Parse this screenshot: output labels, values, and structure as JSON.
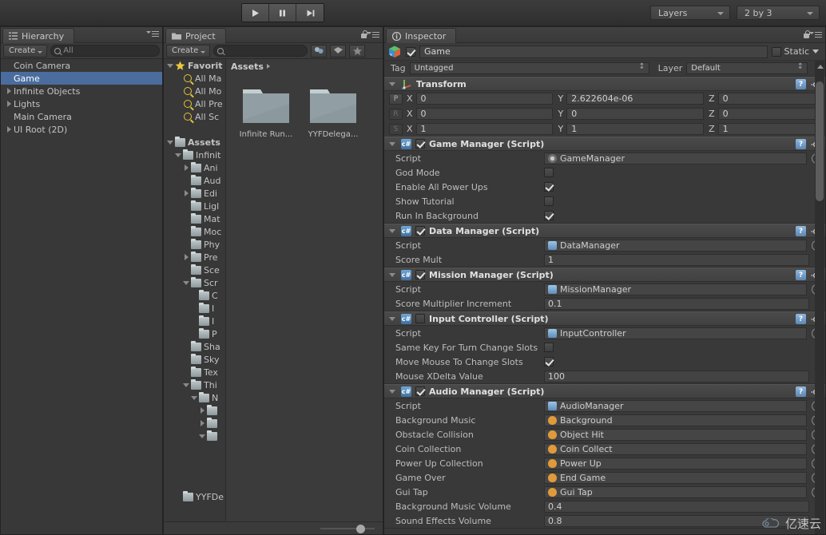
{
  "toolbar": {
    "play_label": "play-icon",
    "pause_label": "pause-icon",
    "step_label": "step-icon",
    "layers_label": "Layers",
    "layout_label": "2 by 3"
  },
  "hierarchy": {
    "tab_label": "Hierarchy",
    "create_label": "Create",
    "search_value": "All",
    "items": [
      {
        "label": "Coin Camera",
        "twisty": "none",
        "selected": false
      },
      {
        "label": "Game",
        "twisty": "none",
        "selected": true
      },
      {
        "label": "Infinite Objects",
        "twisty": "closed",
        "selected": false
      },
      {
        "label": "Lights",
        "twisty": "closed",
        "selected": false
      },
      {
        "label": "Main Camera",
        "twisty": "none",
        "selected": false
      },
      {
        "label": "UI Root (2D)",
        "twisty": "closed",
        "selected": false
      }
    ]
  },
  "project": {
    "tab_label": "Project",
    "create_label": "Create",
    "search_value": "",
    "breadcrumb": "Assets",
    "tree": [
      {
        "label": "Favorit",
        "indent": 0,
        "twisty": "open",
        "icon": "star",
        "bold": true
      },
      {
        "label": "All Ma",
        "indent": 1,
        "twisty": "none",
        "icon": "search",
        "bold": false
      },
      {
        "label": "All Mo",
        "indent": 1,
        "twisty": "none",
        "icon": "search",
        "bold": false
      },
      {
        "label": "All Pre",
        "indent": 1,
        "twisty": "none",
        "icon": "search",
        "bold": false
      },
      {
        "label": "All Sc",
        "indent": 1,
        "twisty": "none",
        "icon": "search",
        "bold": false
      },
      {
        "label": "",
        "indent": 0,
        "twisty": "none",
        "icon": "none",
        "bold": false
      },
      {
        "label": "Assets",
        "indent": 0,
        "twisty": "open",
        "icon": "folder",
        "bold": true
      },
      {
        "label": "Infinit",
        "indent": 1,
        "twisty": "open",
        "icon": "folder",
        "bold": false
      },
      {
        "label": "Ani",
        "indent": 2,
        "twisty": "closed",
        "icon": "folder",
        "bold": false
      },
      {
        "label": "Aud",
        "indent": 2,
        "twisty": "none",
        "icon": "folder",
        "bold": false
      },
      {
        "label": "Edi",
        "indent": 2,
        "twisty": "closed",
        "icon": "folder",
        "bold": false
      },
      {
        "label": "Ligl",
        "indent": 2,
        "twisty": "none",
        "icon": "folder",
        "bold": false
      },
      {
        "label": "Mat",
        "indent": 2,
        "twisty": "none",
        "icon": "folder",
        "bold": false
      },
      {
        "label": "Moc",
        "indent": 2,
        "twisty": "none",
        "icon": "folder",
        "bold": false
      },
      {
        "label": "Phy",
        "indent": 2,
        "twisty": "none",
        "icon": "folder",
        "bold": false
      },
      {
        "label": "Pre",
        "indent": 2,
        "twisty": "closed",
        "icon": "folder",
        "bold": false
      },
      {
        "label": "Sce",
        "indent": 2,
        "twisty": "none",
        "icon": "folder",
        "bold": false
      },
      {
        "label": "Scr",
        "indent": 2,
        "twisty": "open",
        "icon": "folder",
        "bold": false
      },
      {
        "label": "C",
        "indent": 3,
        "twisty": "none",
        "icon": "folder",
        "bold": false
      },
      {
        "label": "I",
        "indent": 3,
        "twisty": "none",
        "icon": "folder",
        "bold": false
      },
      {
        "label": "I",
        "indent": 3,
        "twisty": "none",
        "icon": "folder",
        "bold": false
      },
      {
        "label": "P",
        "indent": 3,
        "twisty": "none",
        "icon": "folder",
        "bold": false
      },
      {
        "label": "Sha",
        "indent": 2,
        "twisty": "none",
        "icon": "folder",
        "bold": false
      },
      {
        "label": "Sky",
        "indent": 2,
        "twisty": "none",
        "icon": "folder",
        "bold": false
      },
      {
        "label": "Tex",
        "indent": 2,
        "twisty": "none",
        "icon": "folder",
        "bold": false
      },
      {
        "label": "Thi",
        "indent": 2,
        "twisty": "open",
        "icon": "folder",
        "bold": false
      },
      {
        "label": "N",
        "indent": 3,
        "twisty": "open",
        "icon": "folder",
        "bold": false
      },
      {
        "label": "",
        "indent": 4,
        "twisty": "closed",
        "icon": "folder",
        "bold": false
      },
      {
        "label": "",
        "indent": 4,
        "twisty": "closed",
        "icon": "folder",
        "bold": false
      },
      {
        "label": "",
        "indent": 4,
        "twisty": "open",
        "icon": "folder",
        "bold": false
      }
    ],
    "tree_bottom_item": {
      "label": "YYFDe",
      "icon": "folder"
    },
    "assets": [
      {
        "label": "Infinite Run...",
        "icon": "folder-large"
      },
      {
        "label": "YYFDelega...",
        "icon": "folder-large"
      }
    ]
  },
  "inspector": {
    "tab_label": "Inspector",
    "object_name": "Game",
    "object_enabled": true,
    "static_label": "Static",
    "static_checked": false,
    "tag_label": "Tag",
    "tag_value": "Untagged",
    "layer_label": "Layer",
    "layer_value": "Default",
    "transform": {
      "title": "Transform",
      "rows": [
        {
          "key": "P",
          "x_label": "X",
          "x": "0",
          "y_label": "Y",
          "y": "2.622604e-06",
          "z_label": "Z",
          "z": "0"
        },
        {
          "key": "R",
          "x_label": "X",
          "x": "0",
          "y_label": "Y",
          "y": "0",
          "z_label": "Z",
          "z": "0"
        },
        {
          "key": "S",
          "x_label": "X",
          "x": "1",
          "y_label": "Y",
          "y": "1",
          "z_label": "Z",
          "z": "1"
        }
      ]
    },
    "components": [
      {
        "title": "Game Manager (Script)",
        "enabled": true,
        "rows": [
          {
            "label": "Script",
            "type": "objref",
            "value": "GameManager",
            "icon": "mono"
          },
          {
            "label": "God Mode",
            "type": "checkbox",
            "value": false
          },
          {
            "label": "Enable All Power Ups",
            "type": "checkbox",
            "value": true
          },
          {
            "label": "Show Tutorial",
            "type": "checkbox",
            "value": false
          },
          {
            "label": "Run In Background",
            "type": "checkbox",
            "value": true
          }
        ]
      },
      {
        "title": "Data Manager (Script)",
        "enabled": true,
        "rows": [
          {
            "label": "Script",
            "type": "objref",
            "value": "DataManager",
            "icon": "script"
          },
          {
            "label": "Score Mult",
            "type": "text",
            "value": "1"
          }
        ]
      },
      {
        "title": "Mission Manager (Script)",
        "enabled": true,
        "rows": [
          {
            "label": "Script",
            "type": "objref",
            "value": "MissionManager",
            "icon": "script"
          },
          {
            "label": "Score Multiplier Increment",
            "type": "text",
            "value": "0.1"
          }
        ]
      },
      {
        "title": "Input Controller (Script)",
        "enabled": false,
        "rows": [
          {
            "label": "Script",
            "type": "objref",
            "value": "InputController",
            "icon": "script"
          },
          {
            "label": "Same Key For Turn Change Slots",
            "type": "checkbox",
            "value": false
          },
          {
            "label": "Move Mouse To Change Slots",
            "type": "checkbox",
            "value": true
          },
          {
            "label": "Mouse XDelta Value",
            "type": "text",
            "value": "100"
          }
        ]
      },
      {
        "title": "Audio Manager (Script)",
        "enabled": true,
        "rows": [
          {
            "label": "Script",
            "type": "objref",
            "value": "AudioManager",
            "icon": "script"
          },
          {
            "label": "Background Music",
            "type": "objref",
            "value": "Background",
            "icon": "audio"
          },
          {
            "label": "Obstacle Collision",
            "type": "objref",
            "value": "Object Hit",
            "icon": "audio"
          },
          {
            "label": "Coin Collection",
            "type": "objref",
            "value": "Coin Collect",
            "icon": "audio"
          },
          {
            "label": "Power Up Collection",
            "type": "objref",
            "value": "Power Up",
            "icon": "audio"
          },
          {
            "label": "Game Over",
            "type": "objref",
            "value": "End Game",
            "icon": "audio"
          },
          {
            "label": "Gui Tap",
            "type": "objref",
            "value": "Gui Tap",
            "icon": "audio"
          },
          {
            "label": "Background Music Volume",
            "type": "text",
            "value": "0.4"
          },
          {
            "label": "Sound Effects Volume",
            "type": "text",
            "value": "0.8"
          }
        ]
      }
    ]
  },
  "watermark": {
    "text": "亿速云"
  },
  "colors": {
    "selection_blue": "#4a6d9e",
    "panel_bg": "#383838",
    "header_bg": "#454545",
    "audio_orange": "#e09a3c",
    "script_blue": "#6fa8d8"
  }
}
